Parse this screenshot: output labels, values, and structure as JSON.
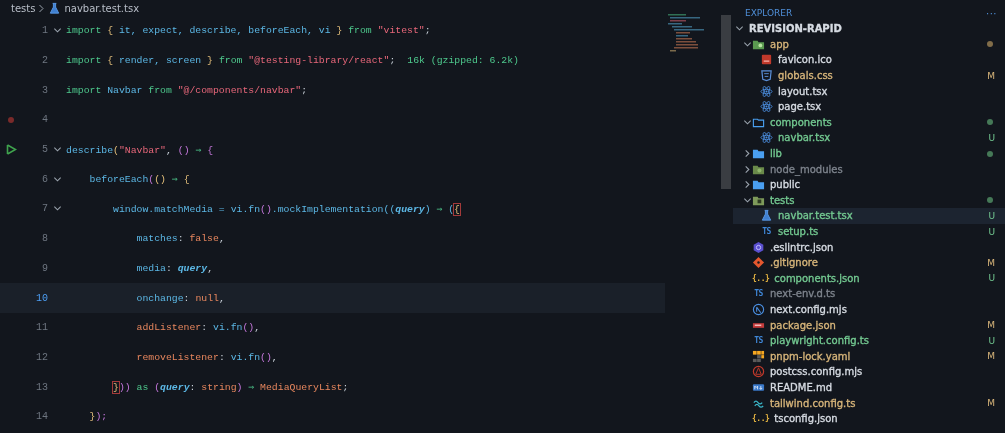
{
  "breadcrumb": {
    "folder": "tests",
    "file": "navbar.test.tsx"
  },
  "editor": {
    "lines": [
      {
        "number": "1",
        "foldable": true,
        "current": false,
        "tokens": [
          {
            "text": "import ",
            "kind": "keyword"
          },
          {
            "text": "{ ",
            "kind": "brace"
          },
          {
            "text": "it, expect, describe, beforeEach, vi ",
            "kind": "name"
          },
          {
            "text": "} ",
            "kind": "brace"
          },
          {
            "text": "from ",
            "kind": "keyword"
          },
          {
            "text": "\"vitest\"",
            "kind": "string"
          },
          {
            "text": ";",
            "kind": "punct"
          }
        ]
      },
      {
        "number": "2",
        "foldable": false,
        "current": false,
        "tokens": [
          {
            "text": "import ",
            "kind": "keyword"
          },
          {
            "text": "{ ",
            "kind": "brace"
          },
          {
            "text": "render, screen ",
            "kind": "name"
          },
          {
            "text": "} ",
            "kind": "brace"
          },
          {
            "text": "from ",
            "kind": "keyword"
          },
          {
            "text": "\"@testing-library/react\"",
            "kind": "string"
          },
          {
            "text": ";",
            "kind": "punct"
          }
        ],
        "hint": "16k (gzipped: 6.2k)"
      },
      {
        "number": "3",
        "foldable": false,
        "current": false,
        "tokens": [
          {
            "text": "import ",
            "kind": "keyword"
          },
          {
            "text": "Navbar ",
            "kind": "name"
          },
          {
            "text": "from ",
            "kind": "keyword"
          },
          {
            "text": "\"@/components/navbar\"",
            "kind": "string"
          },
          {
            "text": ";",
            "kind": "punct"
          }
        ]
      },
      {
        "number": "4",
        "foldable": false,
        "current": false,
        "breakpoint": true
      },
      {
        "number": "5",
        "foldable": true,
        "current": false,
        "runnable": true,
        "tokens": [
          {
            "text": "describe",
            "kind": "name"
          },
          {
            "text": "(",
            "kind": "brace"
          },
          {
            "text": "\"Navbar\"",
            "kind": "string"
          },
          {
            "text": ", ",
            "kind": "punct"
          },
          {
            "text": "() ",
            "kind": "paren"
          },
          {
            "text": "⇒ ",
            "kind": "arrow"
          },
          {
            "text": "{",
            "kind": "paren"
          }
        ]
      },
      {
        "number": "6",
        "foldable": true,
        "current": false,
        "tokens": [
          {
            "text": "    beforeEach",
            "kind": "name"
          },
          {
            "text": "(",
            "kind": "paren"
          },
          {
            "text": "() ",
            "kind": "brace"
          },
          {
            "text": "⇒ ",
            "kind": "arrow"
          },
          {
            "text": "{",
            "kind": "brace"
          }
        ]
      },
      {
        "number": "7",
        "foldable": true,
        "current": false,
        "tokens": [
          {
            "text": "        window.matchMedia = vi.fn",
            "kind": "name"
          },
          {
            "text": "()",
            "kind": "paren"
          },
          {
            "text": ".mockImplementation((",
            "kind": "name"
          },
          {
            "text": "query",
            "kind": "param"
          },
          {
            "text": ") ",
            "kind": "name"
          },
          {
            "text": "⇒ ",
            "kind": "arrow"
          },
          {
            "text": "(",
            "kind": "name"
          },
          {
            "text": "{",
            "kind": "brace",
            "match": true
          }
        ]
      },
      {
        "number": "8",
        "foldable": false,
        "current": false,
        "tokens": [
          {
            "text": "            matches",
            "kind": "name"
          },
          {
            "text": ": ",
            "kind": "punct"
          },
          {
            "text": "false",
            "kind": "literal"
          },
          {
            "text": ",",
            "kind": "punct"
          }
        ]
      },
      {
        "number": "9",
        "foldable": false,
        "current": false,
        "tokens": [
          {
            "text": "            media",
            "kind": "name"
          },
          {
            "text": ": ",
            "kind": "punct"
          },
          {
            "text": "query",
            "kind": "param"
          },
          {
            "text": ",",
            "kind": "punct"
          }
        ]
      },
      {
        "number": "10",
        "foldable": false,
        "current": true,
        "tokens": [
          {
            "text": "            onchange",
            "kind": "name"
          },
          {
            "text": ": ",
            "kind": "punct"
          },
          {
            "text": "null",
            "kind": "literal"
          },
          {
            "text": ",",
            "kind": "punct"
          }
        ]
      },
      {
        "number": "11",
        "foldable": false,
        "current": false,
        "tokens": [
          {
            "text": "            addListener",
            "kind": "literal"
          },
          {
            "text": ": ",
            "kind": "punct"
          },
          {
            "text": "vi.fn",
            "kind": "name"
          },
          {
            "text": "()",
            "kind": "paren"
          },
          {
            "text": ",",
            "kind": "punct"
          }
        ]
      },
      {
        "number": "12",
        "foldable": false,
        "current": false,
        "tokens": [
          {
            "text": "            removeListener",
            "kind": "literal"
          },
          {
            "text": ": ",
            "kind": "punct"
          },
          {
            "text": "vi.fn",
            "kind": "name"
          },
          {
            "text": "()",
            "kind": "paren"
          },
          {
            "text": ",",
            "kind": "punct"
          }
        ]
      },
      {
        "number": "13",
        "foldable": false,
        "current": false,
        "tokens": [
          {
            "text": "        }",
            "kind": "brace",
            "match": true
          },
          {
            "text": ")) ",
            "kind": "paren"
          },
          {
            "text": "as ",
            "kind": "keyword"
          },
          {
            "text": "(",
            "kind": "paren"
          },
          {
            "text": "query",
            "kind": "param"
          },
          {
            "text": ": ",
            "kind": "punct"
          },
          {
            "text": "string",
            "kind": "literal"
          },
          {
            "text": ") ",
            "kind": "paren"
          },
          {
            "text": "⇒ ",
            "kind": "arrow"
          },
          {
            "text": "MediaQueryList",
            "kind": "literal"
          },
          {
            "text": ";",
            "kind": "punct"
          }
        ]
      },
      {
        "number": "14",
        "foldable": false,
        "current": false,
        "tokens": [
          {
            "text": "    }",
            "kind": "brace"
          },
          {
            "text": ");",
            "kind": "paren"
          }
        ]
      }
    ]
  },
  "explorer": {
    "title": "EXPLORER",
    "more": "···",
    "root": {
      "name": "REVISION-RAPID",
      "expanded": true,
      "children": [
        {
          "name": "app",
          "kind": "appfolder",
          "expanded": true,
          "changed": true,
          "color": "#d7b57a",
          "children": [
            {
              "name": "favicon.ico",
              "kind": "image",
              "color": "#d6dbe2",
              "selected": false
            },
            {
              "name": "globals.css",
              "kind": "stylesheet",
              "color": "#d7b57a",
              "badge": "M",
              "selected": false
            },
            {
              "name": "layout.tsx",
              "kind": "react",
              "color": "#d6dbe2",
              "selected": false
            },
            {
              "name": "page.tsx",
              "kind": "react",
              "color": "#d6dbe2",
              "selected": false
            }
          ]
        },
        {
          "name": "components",
          "kind": "outlinefolder",
          "expanded": true,
          "changed": true,
          "color": "#73c991",
          "children": [
            {
              "name": "navbar.tsx",
              "kind": "react",
              "color": "#73c991",
              "badge": "U",
              "selected": false
            }
          ]
        },
        {
          "name": "lib",
          "kind": "folder",
          "expanded": false,
          "changed": true,
          "color": "#73c991"
        },
        {
          "name": "node_modules",
          "kind": "nodefolder",
          "expanded": false,
          "changed": false,
          "color": "#7d838c"
        },
        {
          "name": "public",
          "kind": "folder",
          "expanded": false,
          "changed": false,
          "color": "#d6dbe2"
        },
        {
          "name": "tests",
          "kind": "testfolder",
          "expanded": true,
          "changed": true,
          "color": "#73c991",
          "children": [
            {
              "name": "navbar.test.tsx",
              "kind": "test",
              "color": "#73c991",
              "badge": "U",
              "selected": true
            },
            {
              "name": "setup.ts",
              "kind": "typescript",
              "icon_text": "TS",
              "color": "#73c991",
              "badge": "U",
              "selected": false
            }
          ]
        },
        {
          "name": ".eslintrc.json",
          "kind": "eslint",
          "color": "#d6dbe2",
          "selected": false
        },
        {
          "name": ".gitignore",
          "kind": "git",
          "color": "#d7b57a",
          "badge": "M",
          "selected": false
        },
        {
          "name": "components.json",
          "kind": "json",
          "icon_text": "{..}",
          "color": "#73c991",
          "badge": "U",
          "selected": false
        },
        {
          "name": "next-env.d.ts",
          "kind": "typescript",
          "icon_text": "TS",
          "color": "#7d838c",
          "selected": false
        },
        {
          "name": "next.config.mjs",
          "kind": "next",
          "color": "#d6dbe2",
          "selected": false
        },
        {
          "name": "package.json",
          "kind": "npm",
          "color": "#d7b57a",
          "badge": "M",
          "selected": false
        },
        {
          "name": "playwright.config.ts",
          "kind": "typescript",
          "icon_text": "TS",
          "color": "#73c991",
          "badge": "U",
          "selected": false
        },
        {
          "name": "pnpm-lock.yaml",
          "kind": "pnpm",
          "color": "#d7b57a",
          "badge": "M",
          "selected": false
        },
        {
          "name": "postcss.config.mjs",
          "kind": "postcss",
          "color": "#d6dbe2",
          "selected": false
        },
        {
          "name": "README.md",
          "kind": "markdown",
          "color": "#d6dbe2",
          "selected": false
        },
        {
          "name": "tailwind.config.ts",
          "kind": "tailwind",
          "color": "#d7b57a",
          "badge": "M",
          "selected": false
        },
        {
          "name": "tsconfig.json",
          "kind": "json",
          "icon_text": "{..}",
          "color": "#d6dbe2",
          "selected": false
        }
      ]
    }
  }
}
